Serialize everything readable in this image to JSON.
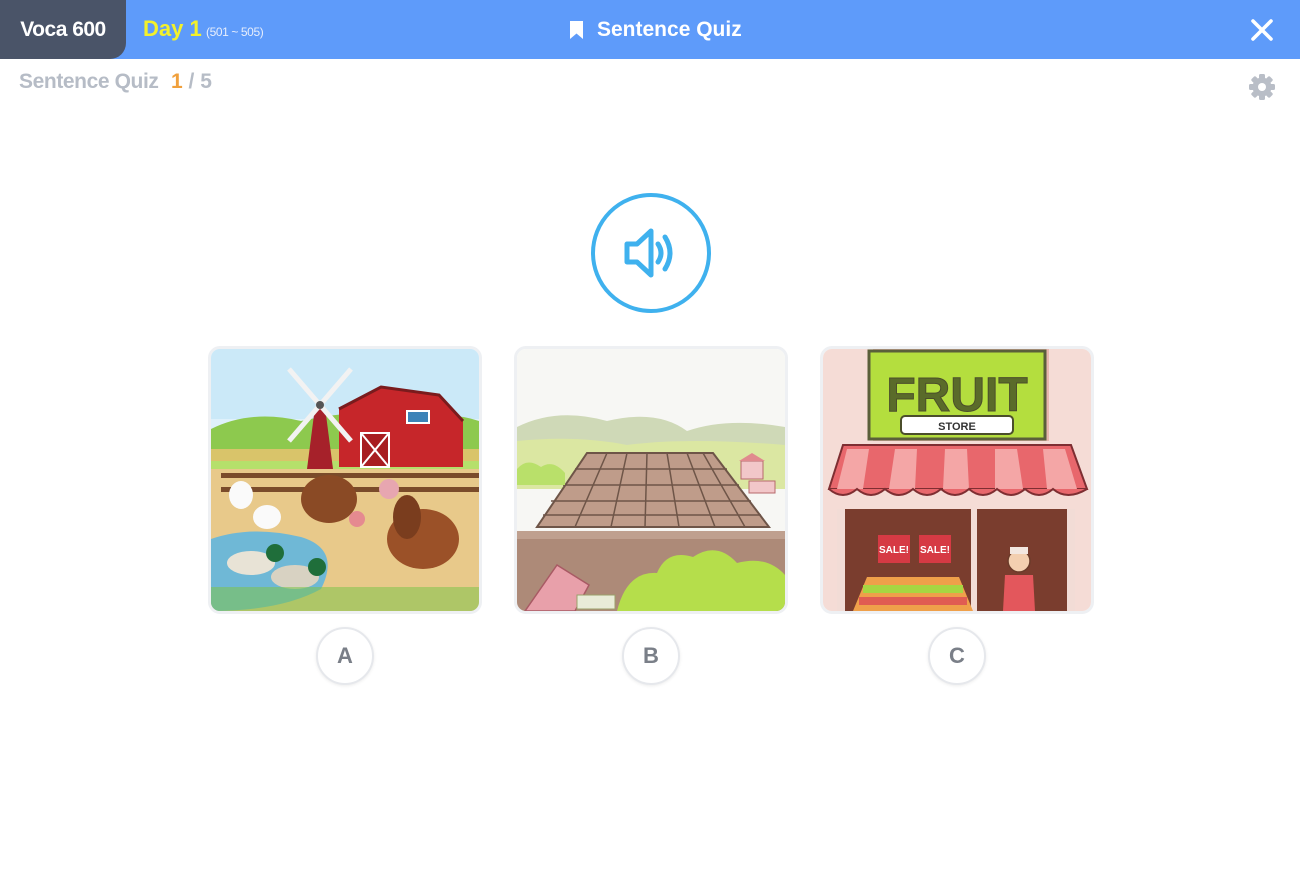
{
  "header": {
    "brand": "Voca 600",
    "day": "Day 1",
    "day_range": "(501 ~ 505)",
    "title": "Sentence Quiz",
    "title_icon": "bookmark-icon",
    "close_icon": "close-icon"
  },
  "quiz": {
    "label": "Sentence Quiz",
    "current": "1",
    "total": "/ 5",
    "progress": 0.2,
    "settings_icon": "gear-icon",
    "play_icon": "speaker-icon"
  },
  "options": [
    {
      "letter": "A",
      "image": "farm with barn, windmill, turkeys, ducks and chickens"
    },
    {
      "letter": "B",
      "image": "plowed field with hills and farmhouse"
    },
    {
      "letter": "C",
      "image": "fruit store storefront",
      "sign": "FRUIT",
      "subsign": "STORE",
      "sale1": "SALE!",
      "sale2": "SALE!"
    }
  ],
  "colors": {
    "header_bg": "#5e9bfa",
    "brand_bg": "#4a5468",
    "day_text": "#f3f12b",
    "counter_current": "#f0a03c",
    "speaker_ring": "#3fb1ee"
  }
}
